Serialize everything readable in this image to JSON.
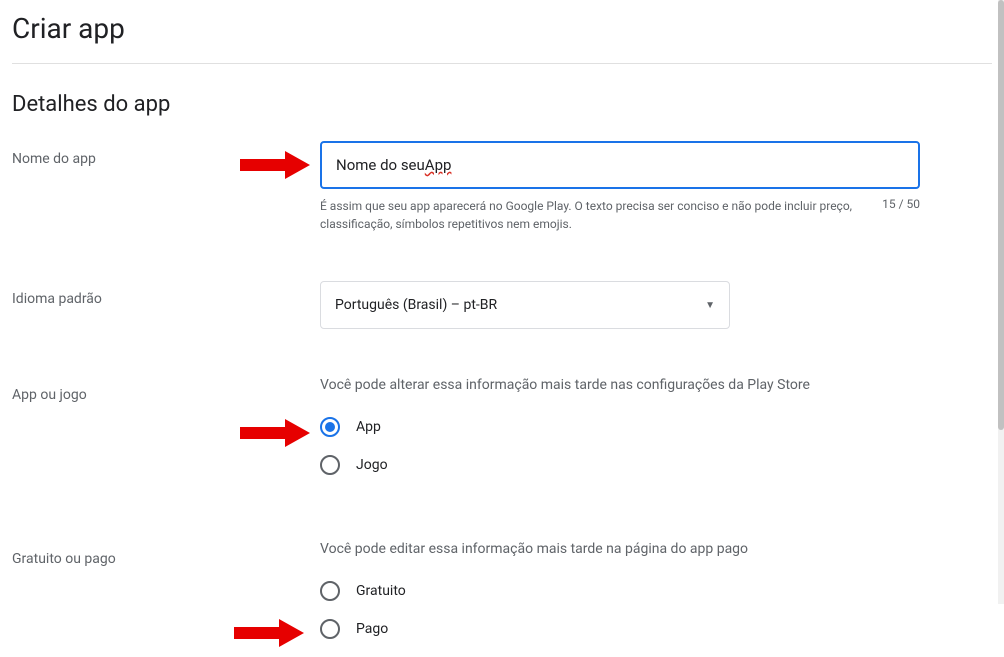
{
  "page": {
    "title": "Criar app",
    "section_title": "Detalhes do app"
  },
  "app_name": {
    "label": "Nome do app",
    "value_prefix": "Nome do seu ",
    "value_underlined": "App",
    "helper": "É assim que seu app aparecerá no Google Play. O texto precisa ser conciso e não pode incluir preço, classificação, símbolos repetitivos nem emojis.",
    "count": "15 / 50"
  },
  "language": {
    "label": "Idioma padrão",
    "value": "Português (Brasil) – pt-BR"
  },
  "app_or_game": {
    "label": "App ou jogo",
    "info": "Você pode alterar essa informação mais tarde nas configurações da Play Store",
    "options": {
      "app": "App",
      "game": "Jogo"
    }
  },
  "free_or_paid": {
    "label": "Gratuito ou pago",
    "info": "Você pode editar essa informação mais tarde na página do app pago",
    "options": {
      "free": "Gratuito",
      "paid": "Pago"
    }
  }
}
